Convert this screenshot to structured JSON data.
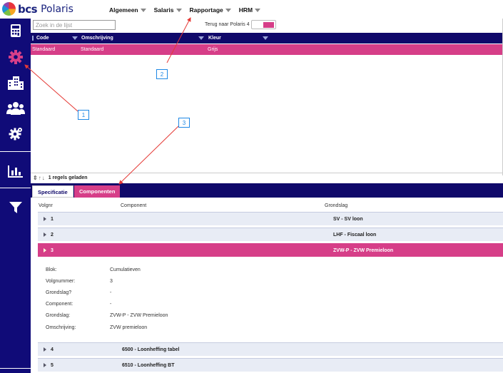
{
  "app": {
    "brand": "bcs",
    "product": "Polaris"
  },
  "menu": [
    {
      "label": "Algemeen"
    },
    {
      "label": "Salaris"
    },
    {
      "label": "Rapportage"
    },
    {
      "label": "HRM"
    }
  ],
  "sidebar": {
    "items": [
      {
        "icon": "calculator-icon"
      },
      {
        "icon": "gear-icon"
      },
      {
        "icon": "buildings-icon"
      },
      {
        "icon": "people-icon"
      },
      {
        "icon": "settings-cog-icon"
      },
      {
        "icon": "bar-chart-icon"
      },
      {
        "icon": "filter-icon"
      }
    ]
  },
  "search": {
    "placeholder": "Zoek in de lijst"
  },
  "back": {
    "label": "Terug naar Polaris 4"
  },
  "grid": {
    "columns": [
      "Code",
      "Omschrijving",
      "Kleur"
    ],
    "rows": [
      {
        "code": "Standaard",
        "omschrijving": "Standaard",
        "kleur": "Grijs"
      }
    ]
  },
  "status": {
    "text": "1 regels geladen"
  },
  "tabs": [
    {
      "label": "Specificatie"
    },
    {
      "label": "Componenten"
    }
  ],
  "detail": {
    "columns": [
      "Volgnr",
      "Component",
      "Grondslag"
    ],
    "rows": [
      {
        "volgnr": "1",
        "component": "",
        "grondslag": "SV - SV loon"
      },
      {
        "volgnr": "2",
        "component": "",
        "grondslag": "LHF - Fiscaal loon"
      },
      {
        "volgnr": "3",
        "component": "",
        "grondslag": "ZVW-P - ZVW Premieloon"
      },
      {
        "volgnr": "4",
        "component": "6500 - Loonheffing tabel",
        "grondslag": ""
      },
      {
        "volgnr": "5",
        "component": "6510 - Loonheffing BT",
        "grondslag": ""
      }
    ],
    "expanded": {
      "fields": [
        {
          "label": "Blok:",
          "value": "Cumulatieven"
        },
        {
          "label": "Volgnummer:",
          "value": "3"
        },
        {
          "label": "Grondslag?",
          "value": "-"
        },
        {
          "label": "Component:",
          "value": "-"
        },
        {
          "label": "Grondslag:",
          "value": "ZVW-P - ZVW Premieloon"
        },
        {
          "label": "Omschrijving:",
          "value": "ZVW premieloon"
        }
      ]
    }
  },
  "annotations": [
    "1",
    "2",
    "3"
  ],
  "colors": {
    "navy": "#10096a",
    "pink": "#d63e88",
    "annotation": "#1e88e5",
    "arrow": "#e53935"
  }
}
